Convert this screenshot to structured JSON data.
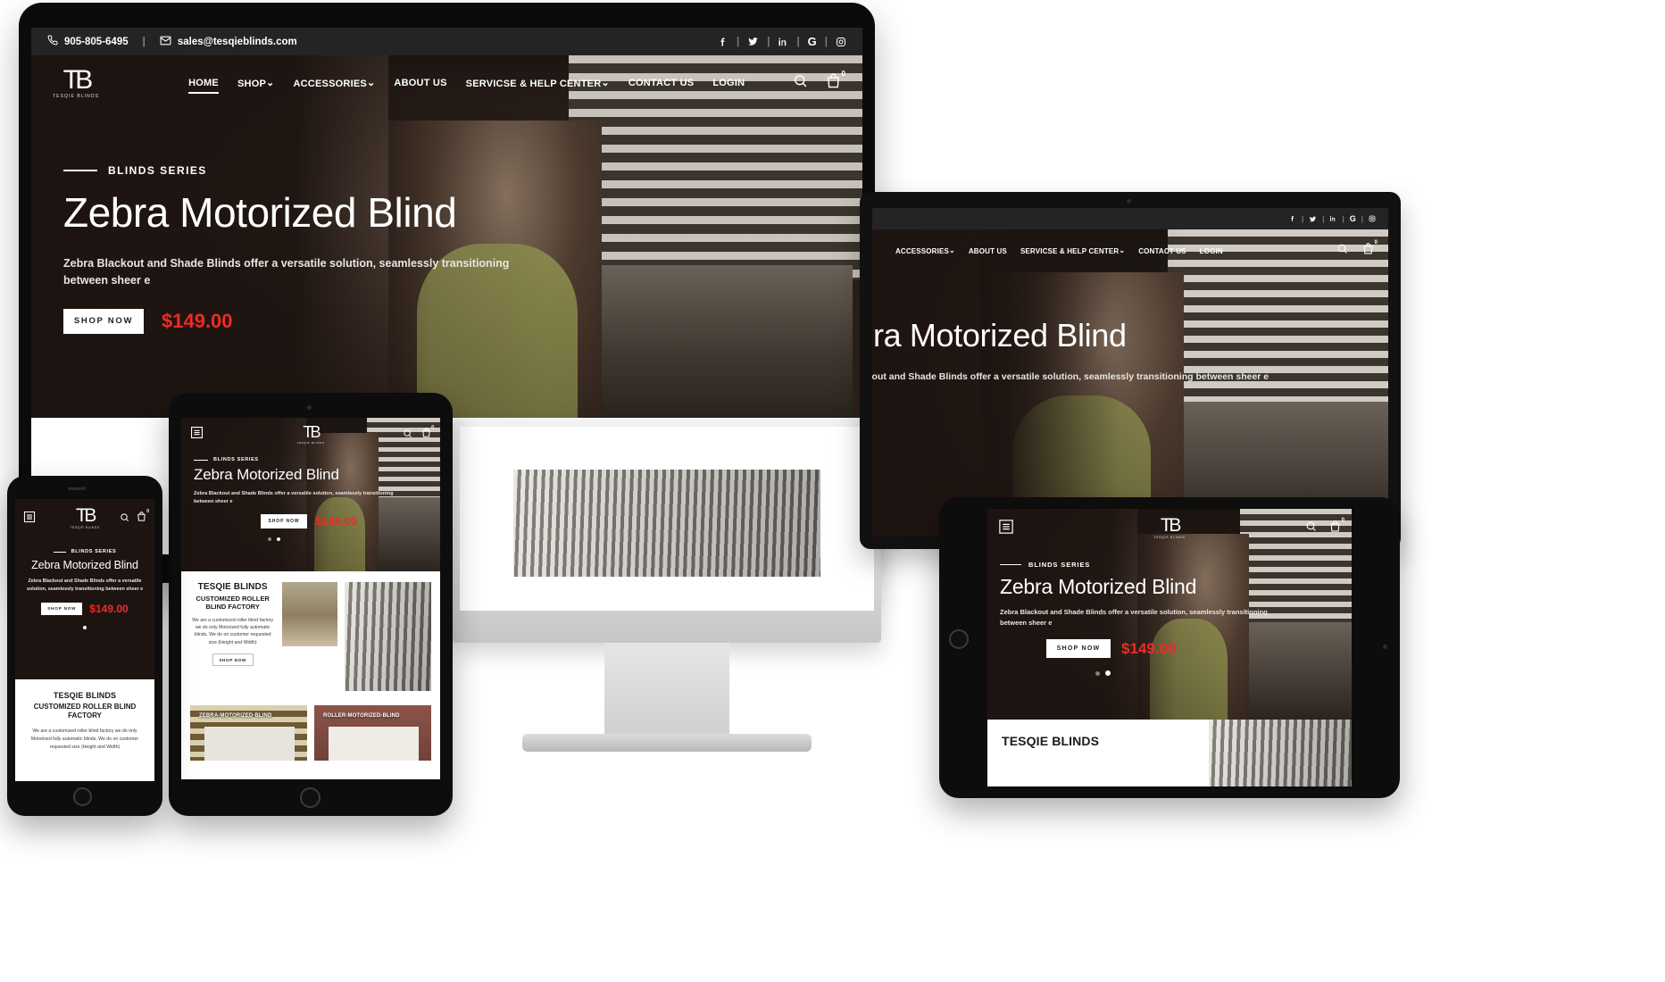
{
  "brand": {
    "logo_mark": "TB",
    "logo_sub": "TESQIE BLINDS",
    "accent_red": "#ee2b24",
    "topbar_bg": "#242424",
    "hero_bg": "#1d1411"
  },
  "topbar": {
    "phone_icon": "phone-icon",
    "phone": "905-805-6495",
    "divider": "|",
    "email_icon": "envelope-icon",
    "email": "sales@tesqieblinds.com",
    "social": [
      {
        "name": "facebook-icon",
        "glyph": "f"
      },
      {
        "name": "twitter-icon",
        "glyph": "ᵛ"
      },
      {
        "name": "linkedin-icon",
        "glyph": "in"
      },
      {
        "name": "google-icon",
        "glyph": "G"
      },
      {
        "name": "instagram-icon",
        "glyph": "◎"
      }
    ],
    "social_separator": "|"
  },
  "nav": {
    "items": [
      {
        "label": "HOME",
        "has_caret": false,
        "active": true
      },
      {
        "label": "SHOP",
        "has_caret": true,
        "active": false
      },
      {
        "label": "ACCESSORIES",
        "has_caret": true,
        "active": false
      },
      {
        "label": "ABOUT US",
        "has_caret": false,
        "active": false
      },
      {
        "label": "SERVICSE & HELP CENTER",
        "has_caret": true,
        "active": false
      },
      {
        "label": "CONTACT US",
        "has_caret": false,
        "active": false
      },
      {
        "label": "LOGIN",
        "has_caret": false,
        "active": false
      }
    ],
    "caret": "⌄",
    "search_icon": "search-icon",
    "cart_icon": "cart-bag-icon",
    "cart_count": "0"
  },
  "hero": {
    "eyebrow": "BLINDS SERIES",
    "title": "Zebra Motorized Blind",
    "subtitle": "Zebra Blackout and Shade Blinds offer a versatile solution, seamlessly transitioning between sheer e",
    "cta_label": "SHOP NOW",
    "price": "$149.00",
    "slide_dots": 2,
    "active_dot": 2,
    "photo_alt": "man-adjusting-zebra-blind-photo"
  },
  "info": {
    "heading": "TESQIE BLINDS",
    "subheading": "CUSTOMIZED ROLLER BLIND FACTORY",
    "body": "We are a customized roller blind factory we do only Motorized fully automatic blinds, We do on customer requested size (Height and Width)",
    "cta_label": "SHOP NOW",
    "image_left_alt": "roller-blind-living-room-photo",
    "image_right_alt": "office-venetian-blinds-photo"
  },
  "tiles": [
    {
      "label": "ZEBRA-MOTORIZED-BLIND",
      "style": "zebra"
    },
    {
      "label": "ROLLER-MOTORIZED-BLIND",
      "style": "roller"
    }
  ],
  "devices": [
    {
      "name": "desktop-monitor-mockup"
    },
    {
      "name": "imac-mockup"
    },
    {
      "name": "laptop-mockup"
    },
    {
      "name": "tablet-landscape-mockup"
    },
    {
      "name": "tablet-portrait-mockup"
    },
    {
      "name": "phone-mockup"
    }
  ],
  "mobile_ui": {
    "menu_icon": "hamburger-menu-icon",
    "search_icon": "search-icon",
    "cart_icon": "cart-bag-icon",
    "cart_count": "0"
  }
}
